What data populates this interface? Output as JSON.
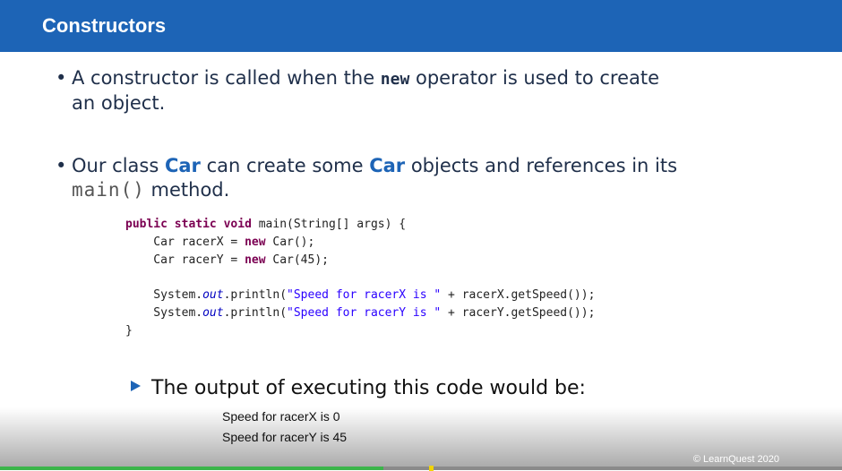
{
  "slide": {
    "title": "Constructors",
    "bullet1": {
      "pre": "A constructor is called when the ",
      "keyword": "new",
      "post": " operator is used to create",
      "line2": "an object."
    },
    "bullet2": {
      "t1": "Our class ",
      "car1": "Car",
      "t2": " can create some ",
      "car2": "Car",
      "t3": " objects and references in its",
      "code": "main()",
      "t4": "  method."
    },
    "code_lines": [
      "public static void main(String[] args) {",
      "    Car racerX = new Car();",
      "    Car racerY = new Car(45);",
      "",
      "    System.out.println(\"Speed for racerX is \" + racerX.getSpeed());",
      "    System.out.println(\"Speed for racerY is \" + racerY.getSpeed());",
      "}"
    ],
    "output_intro": "The output of executing this code would be:",
    "output_lines": [
      "Speed for racerX is 0",
      "Speed for racerY is 45"
    ],
    "copyright": "© LearnQuest 2020"
  },
  "player": {
    "progress_fraction": 0.455,
    "marker_fraction": 0.51
  },
  "colors": {
    "header": "#1d64b6",
    "accent": "#1d64b6",
    "progress": "#3bb54a"
  }
}
